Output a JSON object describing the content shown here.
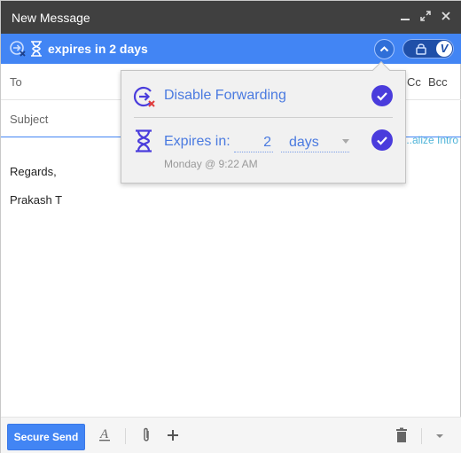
{
  "window": {
    "title": "New Message"
  },
  "banner": {
    "expires_text": "expires in 2 days"
  },
  "fields": {
    "to_label": "To",
    "cc_label": "Cc",
    "bcc_label": "Bcc",
    "subject_label": "Subject",
    "personalize_label": "...alize Intro"
  },
  "body": {
    "lines": [
      "Regards,",
      "Prakash T"
    ]
  },
  "popover": {
    "forwarding": {
      "label": "Disable Forwarding",
      "checked": true
    },
    "expiry": {
      "label": "Expires in:",
      "amount": "2",
      "unit": "days",
      "time": "Monday @ 9:22 AM",
      "checked": true
    }
  },
  "footer": {
    "send_label": "Secure Send"
  },
  "colors": {
    "titlebar": "#404040",
    "banner": "#4285f4",
    "accent_link": "#4a7ae0",
    "check": "#4a3cdc"
  },
  "icons": {
    "minimize": "minimize-icon",
    "popout": "popout-icon",
    "close": "close-icon",
    "forward_block": "forward-block-icon",
    "hourglass": "hourglass-icon",
    "collapse": "chevron-up-icon",
    "lock": "lock-icon",
    "vsend": "v-logo-icon",
    "format": "format-text-icon",
    "attach": "paperclip-icon",
    "more": "plus-icon",
    "discard": "trash-icon",
    "options": "chevron-down-icon"
  }
}
